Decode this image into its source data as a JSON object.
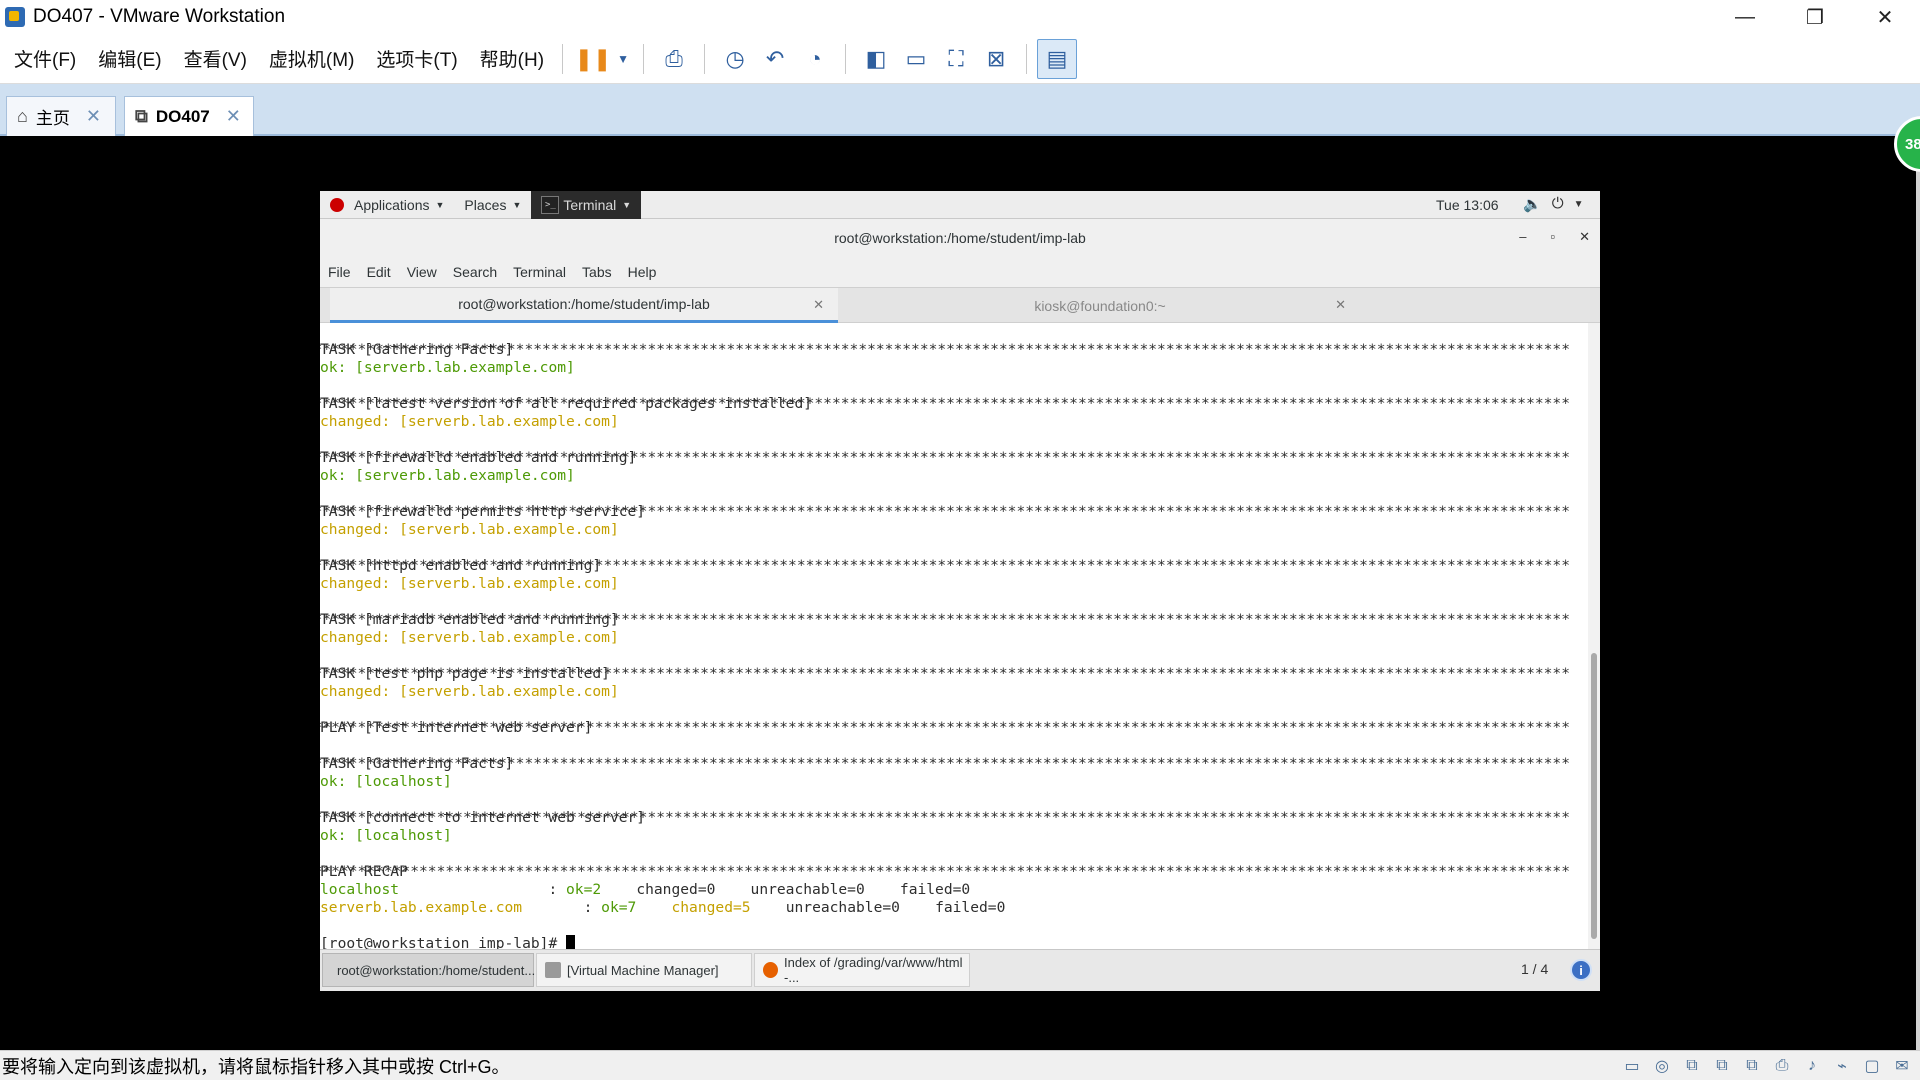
{
  "window": {
    "title": "DO407 - VMware Workstation",
    "controls": {
      "minimize": "—",
      "restore": "❐",
      "close": "✕"
    }
  },
  "menubar": {
    "items": [
      "文件(F)",
      "编辑(E)",
      "查看(V)",
      "虚拟机(M)",
      "选项卡(T)",
      "帮助(H)"
    ]
  },
  "tabs": [
    {
      "label": "主页",
      "icon": "home-icon",
      "active": false
    },
    {
      "label": "DO407",
      "icon": "vm-icon",
      "active": true
    }
  ],
  "badge": {
    "value": "38"
  },
  "statusbar": {
    "text": "要将输入定向到该虚拟机，请将鼠标指针移入其中或按 Ctrl+G。"
  },
  "guest": {
    "topbar": {
      "applications": "Applications",
      "places": "Places",
      "terminal_app": "Terminal",
      "clock": "Tue 13:06"
    },
    "terminal": {
      "title": "root@workstation:/home/student/imp-lab",
      "menu": [
        "File",
        "Edit",
        "View",
        "Search",
        "Terminal",
        "Tabs",
        "Help"
      ],
      "tabs": [
        {
          "label": "root@workstation:/home/student/imp-lab",
          "active": true
        },
        {
          "label": "kiosk@foundation0:~",
          "active": false
        }
      ],
      "lines": {
        "l1": "TASK [Gathering Facts] ",
        "l2": "ok: [serverb.lab.example.com]",
        "l3": "TASK [latest version of all required packages installed] ",
        "l4": "changed: [serverb.lab.example.com]",
        "l5": "TASK [firewalld enabled and running] ",
        "l6": "ok: [serverb.lab.example.com]",
        "l7": "TASK [firewalld permits http service] ",
        "l8": "changed: [serverb.lab.example.com]",
        "l9": "TASK [httpd enabled and running] ",
        "l10": "changed: [serverb.lab.example.com]",
        "l11": "TASK [mariadb enabled and running] ",
        "l12": "changed: [serverb.lab.example.com]",
        "l13": "TASK [test php page is installed] ",
        "l14": "changed: [serverb.lab.example.com]",
        "l15": "PLAY [Test internet web server] ",
        "l16": "TASK [Gathering Facts] ",
        "l17": "ok: [localhost]",
        "l18": "TASK [connect to internet web server] ",
        "l19": "ok: [localhost]",
        "l20": "PLAY RECAP ",
        "recap1_host": "localhost",
        "recap1_sep": "                 : ",
        "recap1_ok": "ok=2",
        "recap1_rest": "    changed=0    unreachable=0    failed=0",
        "recap2_host": "serverb.lab.example.com",
        "recap2_sep": "       : ",
        "recap2_ok": "ok=7",
        "recap2_changed": "    changed=5",
        "recap2_rest": "    unreachable=0    failed=0",
        "prompt": "[root@workstation imp-lab]# "
      },
      "stars": "*****************************************************************************************************************************************************************"
    },
    "taskbar": {
      "items": [
        {
          "label": "root@workstation:/home/student...",
          "active": true
        },
        {
          "label": "[Virtual Machine Manager]",
          "active": false
        },
        {
          "label": "Index of /grading/var/www/html -...",
          "active": false
        }
      ],
      "pager": "1 / 4",
      "info": "i"
    }
  },
  "colors": {
    "ok": "#4e9a06",
    "changed": "#c4a000",
    "tab_bar": "#cfe0f1",
    "badge": "#27b34a"
  }
}
